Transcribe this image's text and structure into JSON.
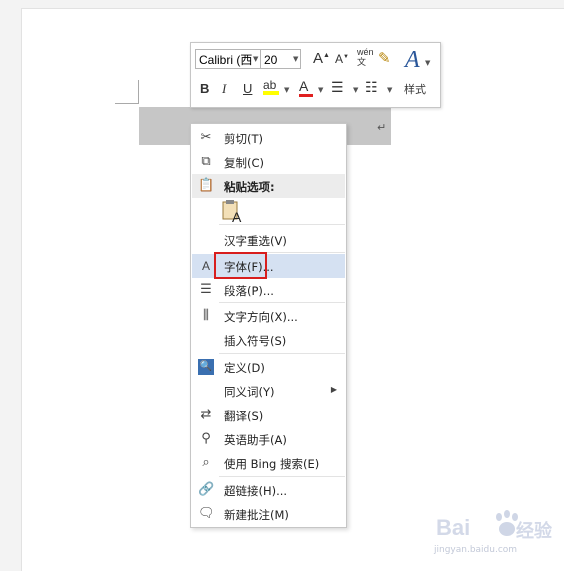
{
  "mini_toolbar": {
    "font_name": "Calibri (西",
    "font_size": "20",
    "styles_label": "样式"
  },
  "context_menu": {
    "items": [
      {
        "label": "剪切(T)",
        "icon": "scissors-icon"
      },
      {
        "label": "复制(C)",
        "icon": "copy-icon"
      },
      {
        "label": "粘贴选项:",
        "icon": "paste-icon"
      },
      {
        "label": "汉字重选(V)"
      },
      {
        "label": "字体(F)...",
        "icon": "font-icon"
      },
      {
        "label": "段落(P)...",
        "icon": "paragraph-icon"
      },
      {
        "label": "文字方向(X)...",
        "icon": "text-direction-icon"
      },
      {
        "label": "插入符号(S)"
      },
      {
        "label": "定义(D)",
        "icon": "define-icon"
      },
      {
        "label": "同义词(Y)"
      },
      {
        "label": "翻译(S)",
        "icon": "translate-icon"
      },
      {
        "label": "英语助手(A)",
        "icon": "english-assistant-icon"
      },
      {
        "label": "使用 Bing 搜索(E)",
        "icon": "bing-search-icon"
      },
      {
        "label": "超链接(H)...",
        "icon": "hyperlink-icon"
      },
      {
        "label": "新建批注(M)",
        "icon": "new-comment-icon"
      }
    ]
  },
  "watermark": {
    "brand": "Bai",
    "brand2": "经验",
    "url": "jingyan.baidu.com"
  }
}
